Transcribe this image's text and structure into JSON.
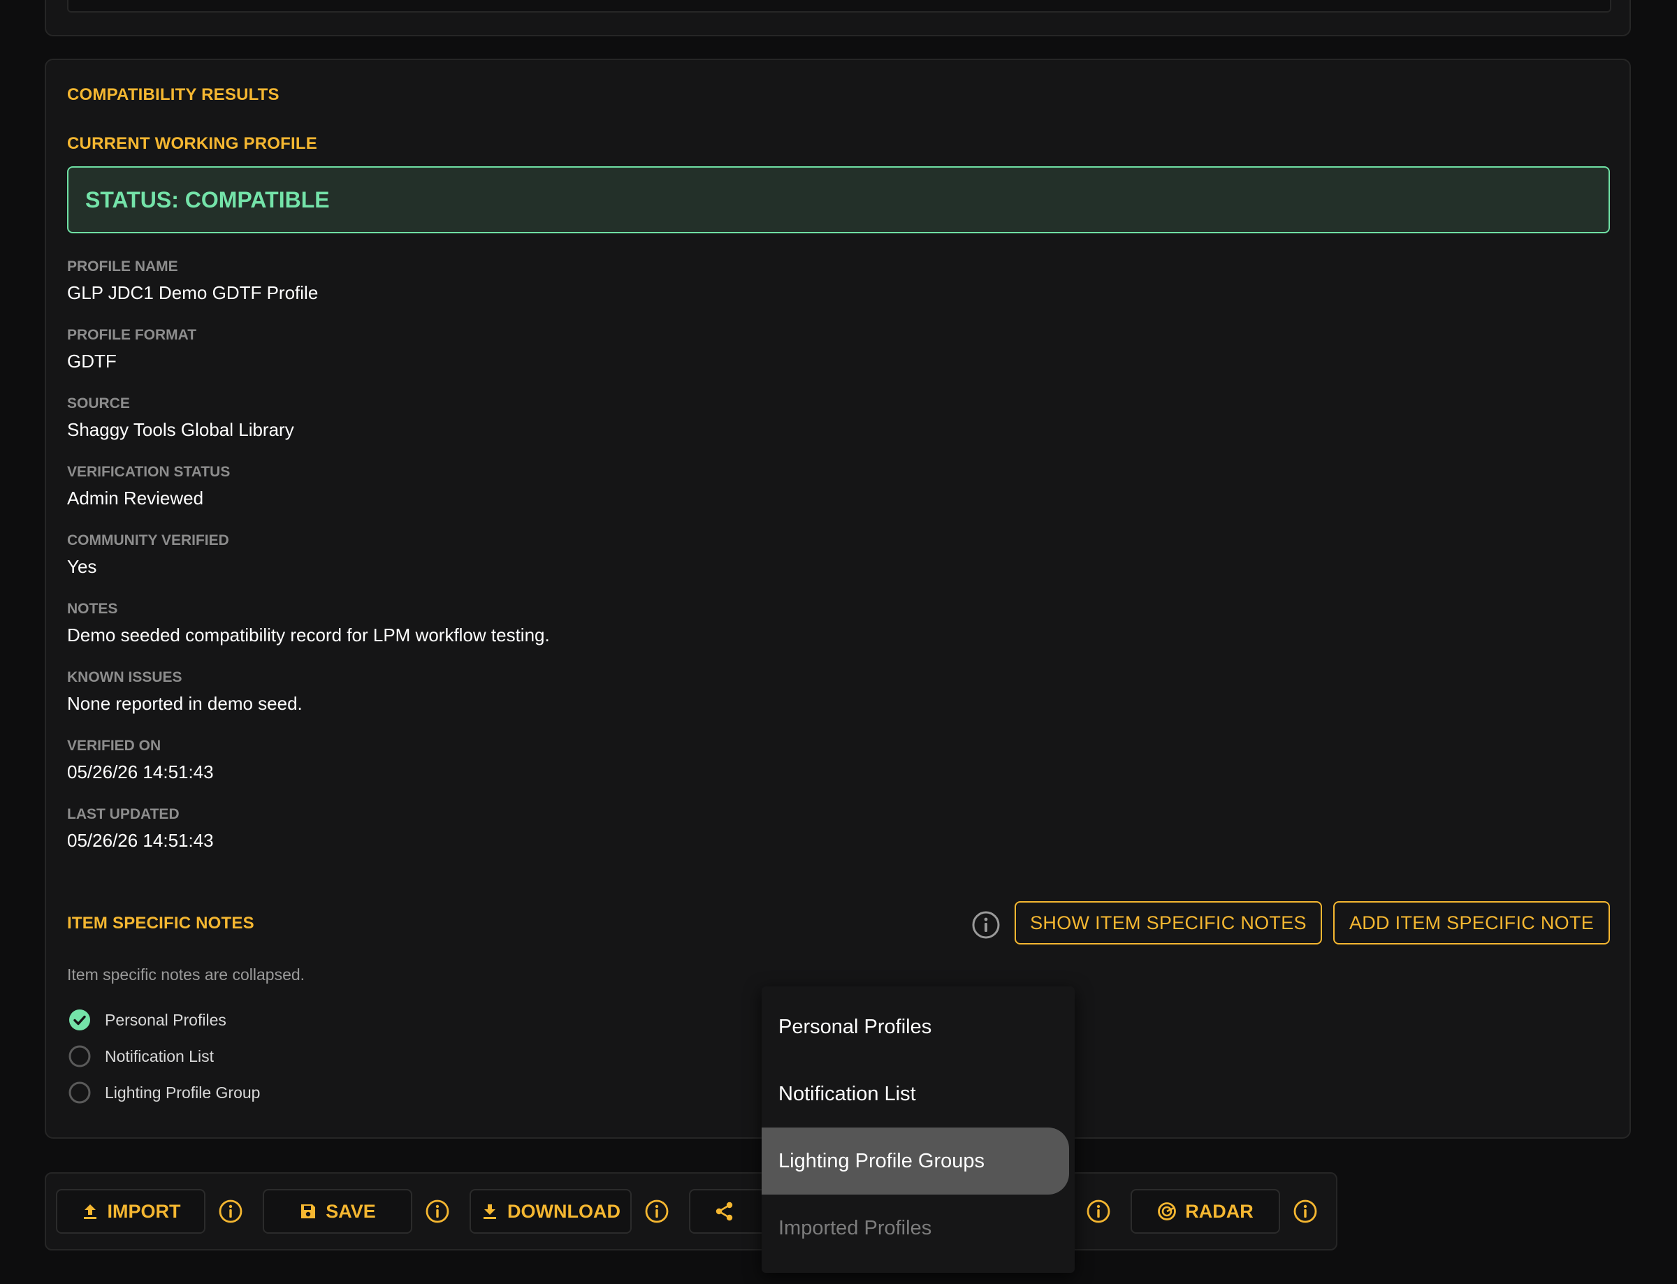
{
  "results": {
    "title": "COMPATIBILITY RESULTS",
    "subtitle": "CURRENT WORKING PROFILE",
    "status": "STATUS: COMPATIBLE",
    "fields": [
      {
        "label": "PROFILE NAME",
        "value": "GLP JDC1 Demo GDTF Profile"
      },
      {
        "label": "PROFILE FORMAT",
        "value": "GDTF"
      },
      {
        "label": "SOURCE",
        "value": "Shaggy Tools Global Library"
      },
      {
        "label": "VERIFICATION STATUS",
        "value": "Admin Reviewed"
      },
      {
        "label": "COMMUNITY VERIFIED",
        "value": "Yes"
      },
      {
        "label": "NOTES",
        "value": "Demo seeded compatibility record for LPM workflow testing."
      },
      {
        "label": "KNOWN ISSUES",
        "value": "None reported in demo seed."
      },
      {
        "label": "VERIFIED ON",
        "value": "05/26/26 14:51:43"
      },
      {
        "label": "LAST UPDATED",
        "value": "05/26/26 14:51:43"
      }
    ]
  },
  "item_notes": {
    "title": "ITEM SPECIFIC NOTES",
    "show_label": "SHOW ITEM SPECIFIC NOTES",
    "add_label": "ADD ITEM SPECIFIC NOTE",
    "collapsed_text": "Item specific notes are collapsed.",
    "targets": [
      {
        "label": "Personal Profiles",
        "checked": true
      },
      {
        "label": "Notification List",
        "checked": false
      },
      {
        "label": "Lighting Profile Group",
        "checked": false
      }
    ]
  },
  "toolbar": {
    "import_label": "IMPORT",
    "save_label": "SAVE",
    "download_label": "DOWNLOAD",
    "radar_label": "RADAR"
  },
  "dropdown": {
    "items": [
      {
        "label": "Personal Profiles",
        "state": "normal"
      },
      {
        "label": "Notification List",
        "state": "normal"
      },
      {
        "label": "Lighting Profile Groups",
        "state": "selected"
      },
      {
        "label": "Imported Profiles",
        "state": "disabled"
      }
    ]
  },
  "colors": {
    "accent": "#f5b731",
    "success": "#74e3a9",
    "background": "#0d0d0e",
    "card": "#151516"
  }
}
